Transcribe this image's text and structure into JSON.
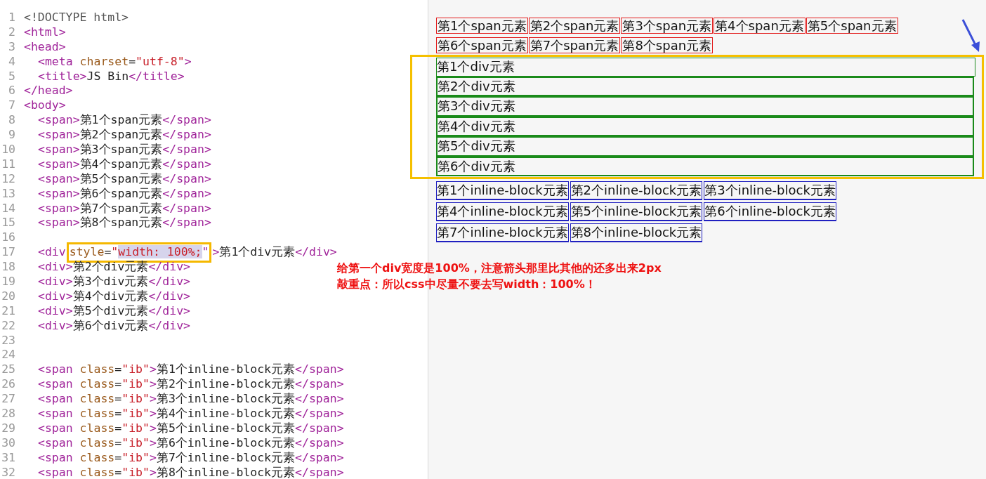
{
  "editor": {
    "lines": [
      {
        "number": "1",
        "indented": false,
        "tokens": [
          {
            "kind": "doctype",
            "text": "<!DOCTYPE html>"
          }
        ]
      },
      {
        "number": "2",
        "indented": false,
        "tokens": [
          {
            "kind": "tag",
            "text": "<html>"
          }
        ]
      },
      {
        "number": "3",
        "indented": false,
        "tokens": [
          {
            "kind": "tag",
            "text": "<head>"
          }
        ]
      },
      {
        "number": "4",
        "indented": true,
        "tokens": [
          {
            "kind": "tag",
            "text": "<meta "
          },
          {
            "kind": "attr",
            "text": "charset"
          },
          {
            "kind": "text",
            "text": "="
          },
          {
            "kind": "string",
            "text": "\"utf-8\""
          },
          {
            "kind": "tag",
            "text": ">"
          }
        ]
      },
      {
        "number": "5",
        "indented": true,
        "tokens": [
          {
            "kind": "tag",
            "text": "<title>"
          },
          {
            "kind": "text",
            "text": "JS Bin"
          },
          {
            "kind": "tag",
            "text": "</title>"
          }
        ]
      },
      {
        "number": "6",
        "indented": false,
        "tokens": [
          {
            "kind": "tag",
            "text": "</head>"
          }
        ]
      },
      {
        "number": "7",
        "indented": false,
        "tokens": [
          {
            "kind": "tag",
            "text": "<body>"
          }
        ]
      },
      {
        "number": "8",
        "indented": true,
        "tokens": [
          {
            "kind": "tag",
            "text": "<span>"
          },
          {
            "kind": "text",
            "text": "第1个span元素"
          },
          {
            "kind": "tag",
            "text": "</span>"
          }
        ]
      },
      {
        "number": "9",
        "indented": true,
        "tokens": [
          {
            "kind": "tag",
            "text": "<span>"
          },
          {
            "kind": "text",
            "text": "第2个span元素"
          },
          {
            "kind": "tag",
            "text": "</span>"
          }
        ]
      },
      {
        "number": "10",
        "indented": true,
        "tokens": [
          {
            "kind": "tag",
            "text": "<span>"
          },
          {
            "kind": "text",
            "text": "第3个span元素"
          },
          {
            "kind": "tag",
            "text": "</span>"
          }
        ]
      },
      {
        "number": "11",
        "indented": true,
        "tokens": [
          {
            "kind": "tag",
            "text": "<span>"
          },
          {
            "kind": "text",
            "text": "第4个span元素"
          },
          {
            "kind": "tag",
            "text": "</span>"
          }
        ]
      },
      {
        "number": "12",
        "indented": true,
        "tokens": [
          {
            "kind": "tag",
            "text": "<span>"
          },
          {
            "kind": "text",
            "text": "第5个span元素"
          },
          {
            "kind": "tag",
            "text": "</span>"
          }
        ]
      },
      {
        "number": "13",
        "indented": true,
        "tokens": [
          {
            "kind": "tag",
            "text": "<span>"
          },
          {
            "kind": "text",
            "text": "第6个span元素"
          },
          {
            "kind": "tag",
            "text": "</span>"
          }
        ]
      },
      {
        "number": "14",
        "indented": true,
        "tokens": [
          {
            "kind": "tag",
            "text": "<span>"
          },
          {
            "kind": "text",
            "text": "第7个span元素"
          },
          {
            "kind": "tag",
            "text": "</span>"
          }
        ]
      },
      {
        "number": "15",
        "indented": true,
        "tokens": [
          {
            "kind": "tag",
            "text": "<span>"
          },
          {
            "kind": "text",
            "text": "第8个span元素"
          },
          {
            "kind": "tag",
            "text": "</span>"
          }
        ]
      },
      {
        "number": "16"
      },
      {
        "number": "17",
        "indented": true,
        "tokens": [
          {
            "kind": "tag",
            "text": "<div"
          },
          {
            "kind": "boxed",
            "children": [
              {
                "kind": "attr",
                "text": "style"
              },
              {
                "kind": "text",
                "text": "="
              },
              {
                "kind": "string",
                "text": "\""
              },
              {
                "kind": "selection",
                "text": "width: 100%;"
              },
              {
                "kind": "tag",
                "text": "\""
              }
            ]
          },
          {
            "kind": "tag",
            "text": ">"
          },
          {
            "kind": "text",
            "text": "第1个div元素"
          },
          {
            "kind": "tag",
            "text": "</div>"
          }
        ]
      },
      {
        "number": "18",
        "indented": true,
        "tokens": [
          {
            "kind": "tag",
            "text": "<div>"
          },
          {
            "kind": "text",
            "text": "第2个div元素"
          },
          {
            "kind": "tag",
            "text": "</div>"
          }
        ]
      },
      {
        "number": "19",
        "indented": true,
        "tokens": [
          {
            "kind": "tag",
            "text": "<div>"
          },
          {
            "kind": "text",
            "text": "第3个div元素"
          },
          {
            "kind": "tag",
            "text": "</div>"
          }
        ]
      },
      {
        "number": "20",
        "indented": true,
        "tokens": [
          {
            "kind": "tag",
            "text": "<div>"
          },
          {
            "kind": "text",
            "text": "第4个div元素"
          },
          {
            "kind": "tag",
            "text": "</div>"
          }
        ]
      },
      {
        "number": "21",
        "indented": true,
        "tokens": [
          {
            "kind": "tag",
            "text": "<div>"
          },
          {
            "kind": "text",
            "text": "第5个div元素"
          },
          {
            "kind": "tag",
            "text": "</div>"
          }
        ]
      },
      {
        "number": "22",
        "indented": true,
        "tokens": [
          {
            "kind": "tag",
            "text": "<div>"
          },
          {
            "kind": "text",
            "text": "第6个div元素"
          },
          {
            "kind": "tag",
            "text": "</div>"
          }
        ]
      },
      {
        "number": "23"
      },
      {
        "number": "24"
      },
      {
        "number": "25",
        "indented": true,
        "tokens": [
          {
            "kind": "tag",
            "text": "<span "
          },
          {
            "kind": "attr",
            "text": "class"
          },
          {
            "kind": "text",
            "text": "="
          },
          {
            "kind": "string",
            "text": "\"ib\""
          },
          {
            "kind": "tag",
            "text": ">"
          },
          {
            "kind": "text",
            "text": "第1个inline-block元素"
          },
          {
            "kind": "tag",
            "text": "</span>"
          }
        ]
      },
      {
        "number": "26",
        "indented": true,
        "tokens": [
          {
            "kind": "tag",
            "text": "<span "
          },
          {
            "kind": "attr",
            "text": "class"
          },
          {
            "kind": "text",
            "text": "="
          },
          {
            "kind": "string",
            "text": "\"ib\""
          },
          {
            "kind": "tag",
            "text": ">"
          },
          {
            "kind": "text",
            "text": "第2个inline-block元素"
          },
          {
            "kind": "tag",
            "text": "</span>"
          }
        ]
      },
      {
        "number": "27",
        "indented": true,
        "tokens": [
          {
            "kind": "tag",
            "text": "<span "
          },
          {
            "kind": "attr",
            "text": "class"
          },
          {
            "kind": "text",
            "text": "="
          },
          {
            "kind": "string",
            "text": "\"ib\""
          },
          {
            "kind": "tag",
            "text": ">"
          },
          {
            "kind": "text",
            "text": "第3个inline-block元素"
          },
          {
            "kind": "tag",
            "text": "</span>"
          }
        ]
      },
      {
        "number": "28",
        "indented": true,
        "tokens": [
          {
            "kind": "tag",
            "text": "<span "
          },
          {
            "kind": "attr",
            "text": "class"
          },
          {
            "kind": "text",
            "text": "="
          },
          {
            "kind": "string",
            "text": "\"ib\""
          },
          {
            "kind": "tag",
            "text": ">"
          },
          {
            "kind": "text",
            "text": "第4个inline-block元素"
          },
          {
            "kind": "tag",
            "text": "</span>"
          }
        ]
      },
      {
        "number": "29",
        "indented": true,
        "tokens": [
          {
            "kind": "tag",
            "text": "<span "
          },
          {
            "kind": "attr",
            "text": "class"
          },
          {
            "kind": "text",
            "text": "="
          },
          {
            "kind": "string",
            "text": "\"ib\""
          },
          {
            "kind": "tag",
            "text": ">"
          },
          {
            "kind": "text",
            "text": "第5个inline-block元素"
          },
          {
            "kind": "tag",
            "text": "</span>"
          }
        ]
      },
      {
        "number": "30",
        "indented": true,
        "tokens": [
          {
            "kind": "tag",
            "text": "<span "
          },
          {
            "kind": "attr",
            "text": "class"
          },
          {
            "kind": "text",
            "text": "="
          },
          {
            "kind": "string",
            "text": "\"ib\""
          },
          {
            "kind": "tag",
            "text": ">"
          },
          {
            "kind": "text",
            "text": "第6个inline-block元素"
          },
          {
            "kind": "tag",
            "text": "</span>"
          }
        ]
      },
      {
        "number": "31",
        "indented": true,
        "tokens": [
          {
            "kind": "tag",
            "text": "<span "
          },
          {
            "kind": "attr",
            "text": "class"
          },
          {
            "kind": "text",
            "text": "="
          },
          {
            "kind": "string",
            "text": "\"ib\""
          },
          {
            "kind": "tag",
            "text": ">"
          },
          {
            "kind": "text",
            "text": "第7个inline-block元素"
          },
          {
            "kind": "tag",
            "text": "</span>"
          }
        ]
      },
      {
        "number": "32",
        "indented": true,
        "tokens": [
          {
            "kind": "tag",
            "text": "<span "
          },
          {
            "kind": "attr",
            "text": "class"
          },
          {
            "kind": "text",
            "text": "="
          },
          {
            "kind": "string",
            "text": "\"ib\""
          },
          {
            "kind": "tag",
            "text": ">"
          },
          {
            "kind": "text",
            "text": "第8个inline-block元素"
          },
          {
            "kind": "tag",
            "text": "</span>"
          }
        ]
      }
    ]
  },
  "output": {
    "spans": [
      "第1个span元素",
      "第2个span元素",
      "第3个span元素",
      "第4个span元素",
      "第5个span元素",
      "第6个span元素",
      "第7个span元素",
      "第8个span元素"
    ],
    "divs": [
      {
        "text": "第1个div元素",
        "full_width": true
      },
      {
        "text": "第2个div元素",
        "full_width": false
      },
      {
        "text": "第3个div元素",
        "full_width": false
      },
      {
        "text": "第4个div元素",
        "full_width": false
      },
      {
        "text": "第5个div元素",
        "full_width": false
      },
      {
        "text": "第6个div元素",
        "full_width": false
      }
    ],
    "inline_blocks": [
      "第1个inline-block元素",
      "第2个inline-block元素",
      "第3个inline-block元素",
      "第4个inline-block元素",
      "第5个inline-block元素",
      "第6个inline-block元素",
      "第7个inline-block元素",
      "第8个inline-block元素"
    ]
  },
  "annotation": {
    "lines": [
      "给第一个div宽度是100%，注意箭头那里比其他的还多出来2px",
      "敲重点：所以css中尽量不要去写width：100%！"
    ]
  }
}
